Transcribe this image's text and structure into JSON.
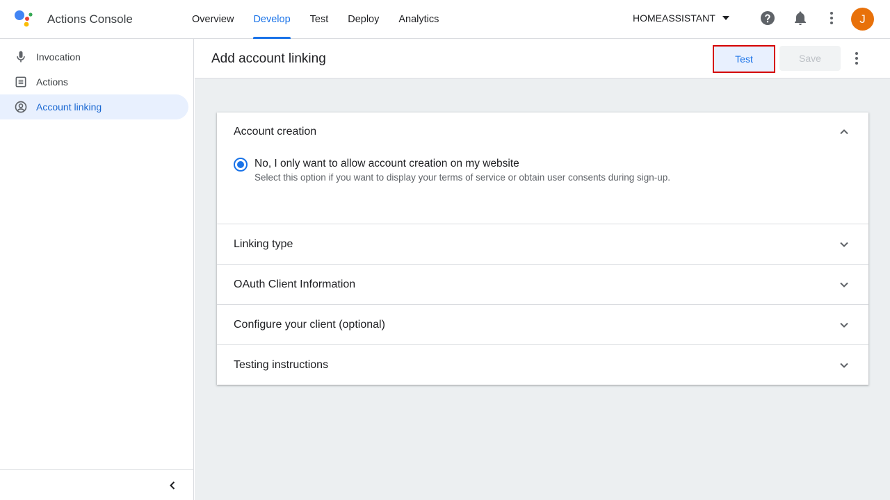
{
  "header": {
    "app_title": "Actions Console",
    "tabs": [
      {
        "label": "Overview"
      },
      {
        "label": "Develop",
        "active": true
      },
      {
        "label": "Test"
      },
      {
        "label": "Deploy"
      },
      {
        "label": "Analytics"
      }
    ],
    "project_name": "HOMEASSISTANT",
    "avatar_initial": "J",
    "icons": [
      "help-icon",
      "bell-icon",
      "more-vert-icon"
    ]
  },
  "sidebar": {
    "items": [
      {
        "label": "Invocation",
        "icon": "mic-icon"
      },
      {
        "label": "Actions",
        "icon": "list-icon"
      },
      {
        "label": "Account linking",
        "icon": "account-circle-icon",
        "active": true
      }
    ]
  },
  "main": {
    "title": "Add account linking",
    "test_label": "Test",
    "save_label": "Save",
    "sections": [
      {
        "title": "Account creation",
        "expanded": true,
        "option_label": "No, I only want to allow account creation on my website",
        "option_help": "Select this option if you want to display your terms of service or obtain user consents during sign-up."
      },
      {
        "title": "Linking type"
      },
      {
        "title": "OAuth Client Information"
      },
      {
        "title": "Configure your client (optional)"
      },
      {
        "title": "Testing instructions"
      }
    ]
  },
  "colors": {
    "accent": "#1a73e8",
    "avatar": "#e8710a",
    "highlight_border": "#d50000",
    "content_bg": "#eceff1"
  }
}
